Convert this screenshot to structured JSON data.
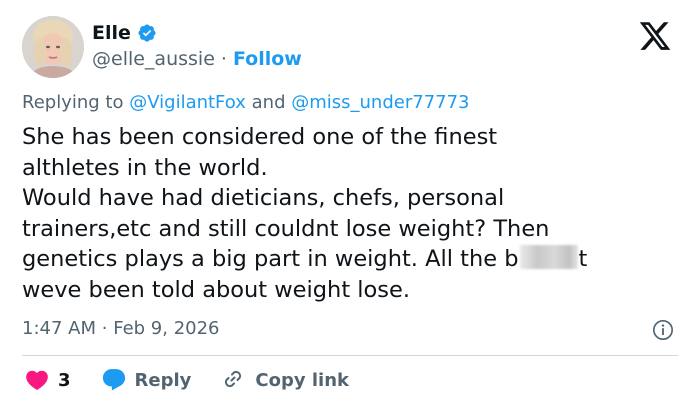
{
  "author": {
    "name": "Elle",
    "handle": "@elle_aussie",
    "separator": "·",
    "follow_label": "Follow"
  },
  "reply_context": {
    "prefix": "Replying to",
    "mention1": "@VigilantFox",
    "connector": "and",
    "mention2": "@miss_under77773"
  },
  "tweet": {
    "lines": [
      "She has been considered one of the finest",
      "althletes in the world.",
      "Would have had dieticians, chefs, personal",
      "trainers,etc and still couldnt lose weight? Then",
      "genetics plays a big part in weight. All the b",
      "weve been told about weight lose."
    ],
    "line5_tail": "t"
  },
  "meta": {
    "time": "1:47 AM",
    "separator": "·",
    "date": "Feb 9, 2026"
  },
  "actions": {
    "like_count": "3",
    "reply_label": "Reply",
    "copy_label": "Copy link"
  },
  "icons": {
    "verified": "verified-badge-icon",
    "logo": "x-logo-icon",
    "info": "info-icon",
    "like": "heart-icon",
    "reply": "speech-bubble-icon",
    "copy": "link-icon"
  },
  "colors": {
    "accent": "#1d9bf0",
    "like": "#f91880",
    "muted": "#536471",
    "text": "#0f1419"
  }
}
